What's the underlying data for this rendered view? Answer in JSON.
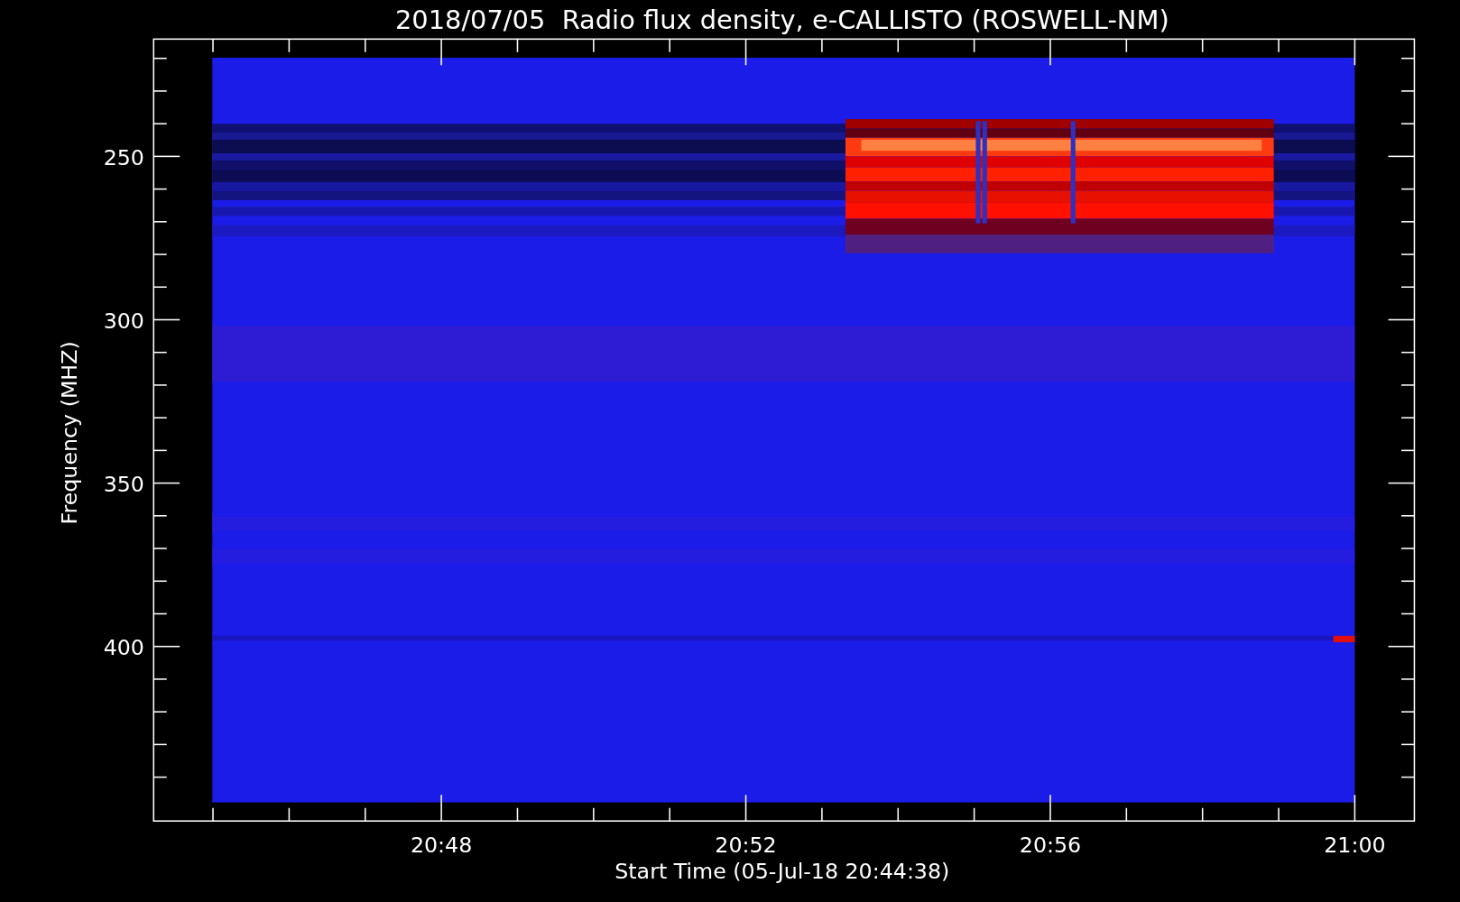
{
  "title": "2018/07/05  Radio flux density, e-CALLISTO (ROSWELL-NM)",
  "y_axis": {
    "label": "Frequency (MHZ)",
    "ticks": [
      "250",
      "300",
      "350",
      "400"
    ]
  },
  "x_axis": {
    "label": "Start Time (05-Jul-18 20:44:38)",
    "ticks": [
      "20:48",
      "20:52",
      "20:56",
      "21:00"
    ]
  }
}
